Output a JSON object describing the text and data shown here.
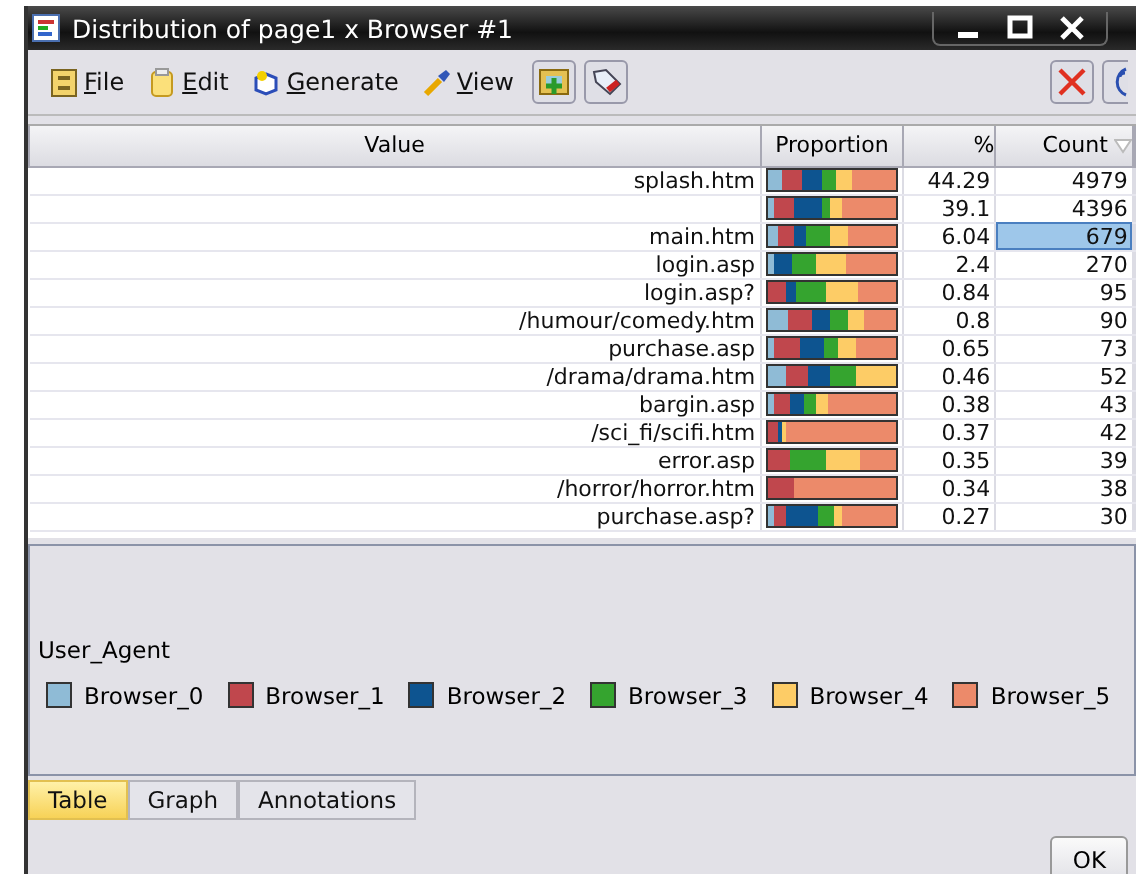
{
  "window": {
    "title": "Distribution of page1 x Browser #1"
  },
  "menu": [
    {
      "label": "File",
      "kind": "file"
    },
    {
      "label": "Edit",
      "kind": "edit"
    },
    {
      "label": "Generate",
      "kind": "generate"
    },
    {
      "label": "View",
      "kind": "view"
    }
  ],
  "table": {
    "columns": [
      "Value",
      "Proportion",
      "%",
      "Count"
    ],
    "rows": [
      {
        "value": "splash.htm",
        "percent": "44.29",
        "count": "4979",
        "selected": false
      },
      {
        "value": "",
        "percent": "39.1",
        "count": "4396",
        "selected": false
      },
      {
        "value": "main.htm",
        "percent": "6.04",
        "count": "679",
        "selected": true
      },
      {
        "value": "login.asp",
        "percent": "2.4",
        "count": "270",
        "selected": false
      },
      {
        "value": "login.asp?",
        "percent": "0.84",
        "count": "95",
        "selected": false
      },
      {
        "value": "/humour/comedy.htm",
        "percent": "0.8",
        "count": "90",
        "selected": false
      },
      {
        "value": "purchase.asp",
        "percent": "0.65",
        "count": "73",
        "selected": false
      },
      {
        "value": "/drama/drama.htm",
        "percent": "0.46",
        "count": "52",
        "selected": false
      },
      {
        "value": "bargin.asp",
        "percent": "0.38",
        "count": "43",
        "selected": false
      },
      {
        "value": "/sci_fi/scifi.htm",
        "percent": "0.37",
        "count": "42",
        "selected": false
      },
      {
        "value": "error.asp",
        "percent": "0.35",
        "count": "39",
        "selected": false
      },
      {
        "value": "/horror/horror.htm",
        "percent": "0.34",
        "count": "38",
        "selected": false
      },
      {
        "value": "purchase.asp?",
        "percent": "0.27",
        "count": "30",
        "selected": false
      }
    ]
  },
  "legend": {
    "title": "User_Agent",
    "items": [
      {
        "label": "Browser_0",
        "color": "#8fbbd6"
      },
      {
        "label": "Browser_1",
        "color": "#c0474d"
      },
      {
        "label": "Browser_2",
        "color": "#0d5490"
      },
      {
        "label": "Browser_3",
        "color": "#35a42f"
      },
      {
        "label": "Browser_4",
        "color": "#fdcc66"
      },
      {
        "label": "Browser_5",
        "color": "#ec8a6a"
      }
    ]
  },
  "tabs": [
    {
      "label": "Table",
      "selected": true
    },
    {
      "label": "Graph",
      "selected": false
    },
    {
      "label": "Annotations",
      "selected": false
    }
  ],
  "buttons": [
    "OK"
  ]
}
